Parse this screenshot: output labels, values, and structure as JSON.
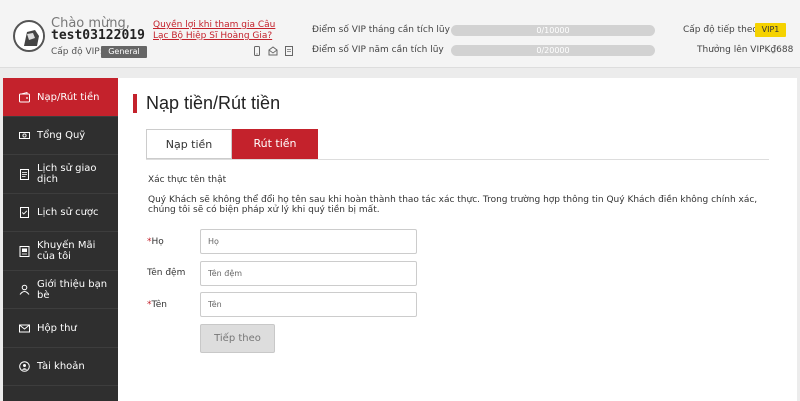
{
  "header": {
    "welcome": "Chào mừng,",
    "username": "test03122019",
    "vip_level_label": "Cấp độ VIP:",
    "vip_level_value": "General",
    "promo_link": "Quyền lợi khi tham gia Câu Lạc Bộ Hiệp Sĩ Hoàng Gia?",
    "icons": [
      "phone-icon",
      "mail-icon",
      "document-icon"
    ],
    "monthly_points_label": "Điểm số VIP tháng cần tích lũy",
    "monthly_points_value": "0/10000",
    "monthly_progress": 0,
    "yearly_points_label": "Điểm số VIP năm cần tích lũy",
    "yearly_points_value": "0/20000",
    "yearly_progress": 0,
    "next_level_label": "Cấp độ tiếp theo:",
    "next_level_value": "VIP1",
    "upgrade_reward": "Thưởng lên VIPK₫688"
  },
  "sidebar": {
    "items": [
      {
        "label": "Nạp/Rút tiền",
        "icon": "wallet-icon",
        "active": true
      },
      {
        "label": "Tổng Quỹ",
        "icon": "money-icon",
        "active": false
      },
      {
        "label": "Lịch sử giao dịch",
        "icon": "history-icon",
        "active": false
      },
      {
        "label": "Lịch sử cược",
        "icon": "bet-history-icon",
        "active": false
      },
      {
        "label": "Khuyến Mãi của tôi",
        "icon": "gift-icon",
        "active": false
      },
      {
        "label": "Giới thiệu bạn bè",
        "icon": "user-icon",
        "active": false
      },
      {
        "label": "Hộp thư",
        "icon": "mail-icon",
        "active": false
      },
      {
        "label": "Tài khoản",
        "icon": "account-icon",
        "active": false
      }
    ]
  },
  "main": {
    "title": "Nạp tiền/Rút tiền",
    "tabs": [
      {
        "label": "Nạp tiền",
        "active": false
      },
      {
        "label": "Rút tiền",
        "active": true
      }
    ],
    "section_title": "Xác thực tên thật",
    "notice": "Quý Khách sẽ không thể đổi họ tên sau khi hoàn thành thao tác xác thực. Trong trường hợp thông tin Quý Khách điền không chính xác, chúng tôi sẽ có biện pháp xử lý khi quý tiền bị mất.",
    "form": {
      "last_name": {
        "required_mark": "*",
        "label": "Họ",
        "placeholder": "Họ",
        "value": ""
      },
      "middle_name": {
        "label": "Tên đệm",
        "placeholder": "Tên đệm",
        "value": ""
      },
      "first_name": {
        "required_mark": "*",
        "label": "Tên",
        "placeholder": "Tên",
        "value": ""
      },
      "submit_label": "Tiếp theo"
    }
  },
  "colors": {
    "accent": "#c4222c",
    "sidebar_bg": "#2f2f2f",
    "vip_badge": "#f5d200"
  }
}
